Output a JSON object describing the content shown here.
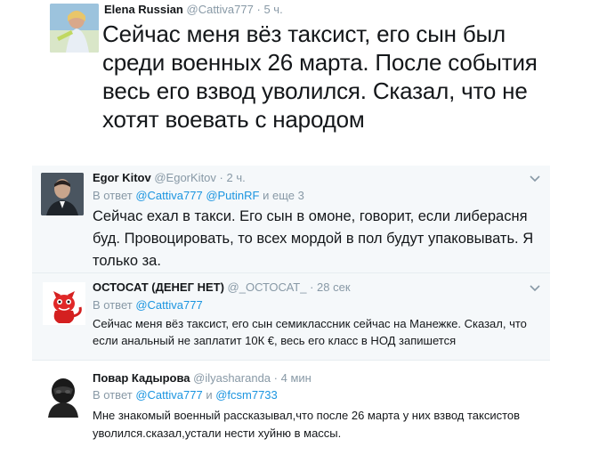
{
  "tweets": [
    {
      "name": "Elena Russian",
      "handle": "@Cattiva777",
      "dot": "·",
      "time": "5 ч.",
      "text": "Сейчас меня вёз таксист, его сын был среди военных 26 марта. После события весь его взвод уволился. Сказал, что не хотят воевать с народом"
    },
    {
      "name": "Egor Kitov",
      "handle": "@EgorKitov",
      "dot": "·",
      "time": "2 ч.",
      "reply_prefix": "В ответ",
      "reply_mentions": [
        "@Cattiva777",
        "@PutinRF"
      ],
      "reply_suffix": "и еще 3",
      "text": "Сейчас ехал в такси. Его сын в омоне, говорит, если либерасня буд. Провоцировать, то всех мордой в пол будут упаковывать. Я только за.",
      "menu_icon": "chevron-down-icon"
    },
    {
      "name": "ОСТОСАТ (ДЕНЕГ НЕТ)",
      "handle": "@_ОСТОСАТ_",
      "dot": "·",
      "time": "28 сек",
      "reply_prefix": "В ответ",
      "reply_mentions": [
        "@Cattiva777"
      ],
      "text": "Сейчас меня вёз таксист, его сын семиклассник сейчас на Манежке. Сказал, что если анальный не заплатит 10К €, весь его класс в НОД запишется",
      "menu_icon": "chevron-down-icon"
    },
    {
      "name": "Повар Кадырова",
      "handle": "@ilyasharanda",
      "dot": "·",
      "time": "4 мин",
      "reply_prefix": "В ответ",
      "reply_mentions": [
        "@Cattiva777",
        "@fcsm7733"
      ],
      "reply_joiner": "и",
      "text": "Мне знакомый военный рассказывал,что после 26 марта у них взвод таксистов уволился.сказал,устали нести хуйню в массы."
    }
  ],
  "colors": {
    "text": "#14171a",
    "muted": "#8899a6",
    "link": "#1b95e0",
    "reply_bg": "#f5f8fa",
    "divider": "#e6ecf0"
  }
}
